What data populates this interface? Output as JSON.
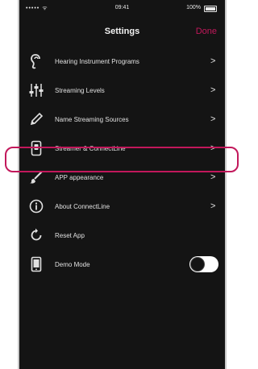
{
  "status_bar": {
    "carrier": "••••• ᯤ",
    "time": "09:41",
    "battery": "100%"
  },
  "nav": {
    "title": "Settings",
    "done_label": "Done"
  },
  "menu_items": [
    {
      "label": "Hearing Instrument Programs",
      "icon": "ear-icon",
      "has_chevron": true
    },
    {
      "label": "Streaming Levels",
      "icon": "sliders-icon",
      "has_chevron": true
    },
    {
      "label": "Name Streaming Sources",
      "icon": "pencil-icon",
      "has_chevron": true
    },
    {
      "label": "Streamer & ConnectLine",
      "icon": "streamer-device-icon",
      "has_chevron": true,
      "highlighted": true
    },
    {
      "label": "APP appearance",
      "icon": "paintbrush-icon",
      "has_chevron": true
    },
    {
      "label": "About ConnectLine",
      "icon": "info-icon",
      "has_chevron": true
    },
    {
      "label": "Reset App",
      "icon": "reset-icon",
      "has_chevron": false
    },
    {
      "label": "Demo Mode",
      "icon": "phone-icon",
      "has_toggle": true,
      "toggle_on": false
    }
  ],
  "colors": {
    "accent": "#c2185b",
    "background": "#141414",
    "text": "#e0e0e0"
  }
}
